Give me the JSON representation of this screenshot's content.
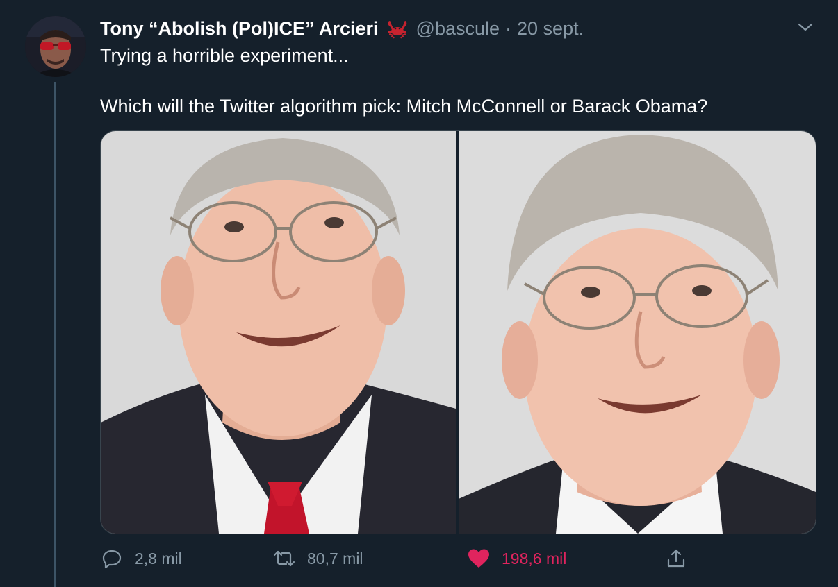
{
  "tweet": {
    "author": {
      "display_name": "Tony “Abolish (Pol)ICE” Arcieri",
      "emoji": "crab-icon",
      "handle": "@bascule",
      "separator": "·",
      "date": "20 sept."
    },
    "text": {
      "line1": "Trying a horrible experiment...",
      "line2": "Which will the Twitter algorithm pick: Mitch McConnell or Barack Obama?"
    },
    "media": {
      "images": [
        "photo-left",
        "photo-right"
      ]
    },
    "actions": {
      "reply_count": "2,8 mil",
      "retweet_count": "80,7 mil",
      "like_count": "198,6 mil"
    }
  },
  "colors": {
    "background": "#15202b",
    "text_primary": "#ffffff",
    "text_secondary": "#8899a6",
    "like_active": "#e0245e",
    "border": "#38444d",
    "thread_line": "#3d5466"
  }
}
